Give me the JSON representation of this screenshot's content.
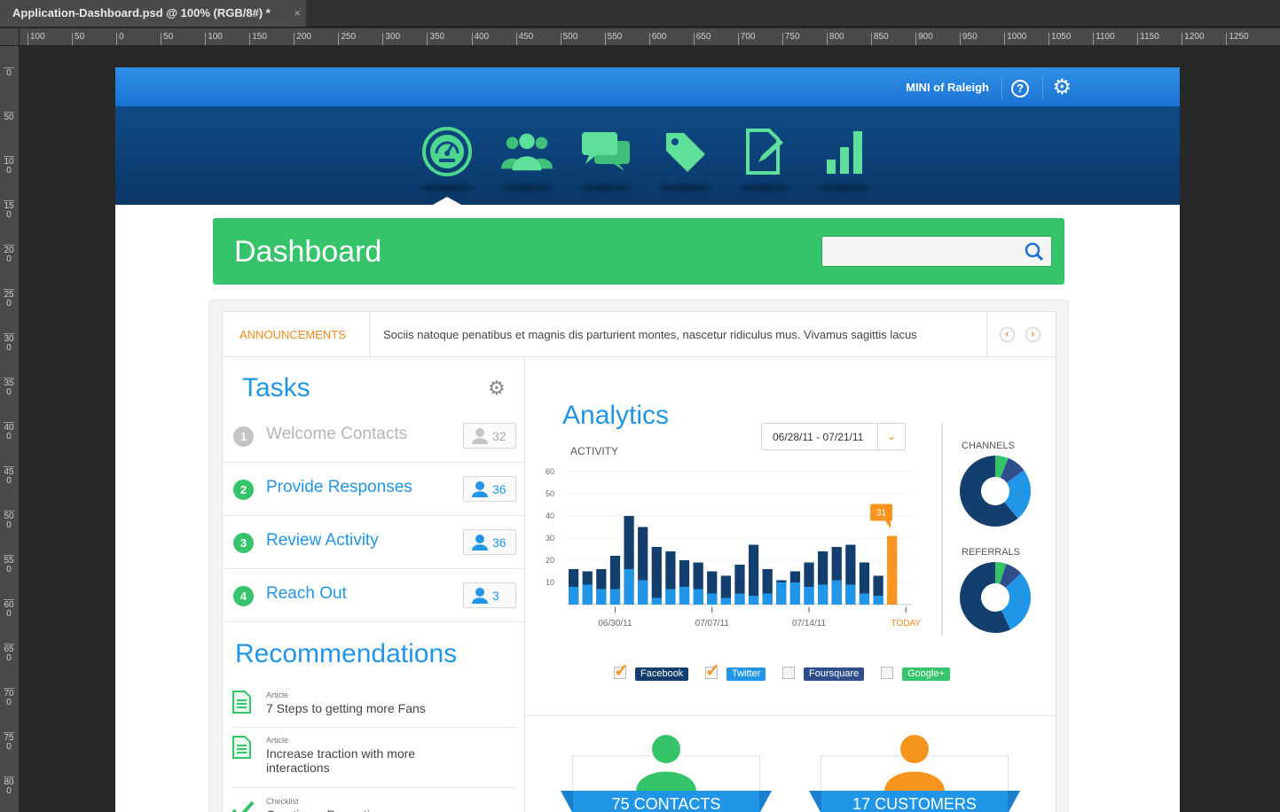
{
  "window": {
    "tab_title": "Application-Dashboard.psd @ 100% (RGB/8#) *",
    "close_glyph": "×"
  },
  "ruler_top": [
    "100",
    "50",
    "0",
    "50",
    "100",
    "150",
    "200",
    "250",
    "300",
    "350",
    "400",
    "450",
    "500",
    "550",
    "600",
    "650",
    "700",
    "750",
    "800",
    "850",
    "900",
    "950",
    "1000",
    "1050",
    "1100",
    "1150",
    "1200",
    "1250"
  ],
  "ruler_left": [
    "0",
    "50",
    "100",
    "150",
    "200",
    "250",
    "300",
    "350",
    "400",
    "450",
    "500",
    "550",
    "600",
    "650",
    "700",
    "750",
    "800"
  ],
  "header": {
    "brand": "MINI of Raleigh",
    "help_glyph": "?",
    "settings_glyph": "⚙"
  },
  "nav_icons": [
    "dashboard-icon",
    "contacts-icon",
    "messages-icon",
    "tags-icon",
    "notes-icon",
    "analytics-bars-icon"
  ],
  "dashboard": {
    "title": "Dashboard",
    "search_value": ""
  },
  "announcement": {
    "label": "ANNOUNCEMENTS",
    "text": "Sociis natoque penatibus et magnis dis parturient montes, nascetur ridiculus mus. Vivamus sagittis lacus",
    "prev": "‹",
    "next": "›"
  },
  "tasks": {
    "title": "Tasks",
    "gear_glyph": "⚙",
    "items": [
      {
        "num": "1",
        "label": "Welcome Contacts",
        "count": "32",
        "state": "done"
      },
      {
        "num": "2",
        "label": "Provide Responses",
        "count": "36",
        "state": "active"
      },
      {
        "num": "3",
        "label": "Review Activity",
        "count": "36",
        "state": "active"
      },
      {
        "num": "4",
        "label": "Reach Out",
        "count": "3",
        "state": "active"
      }
    ]
  },
  "recommendations": {
    "title": "Recommendations",
    "items": [
      {
        "type": "Article",
        "text": "7 Steps to getting more Fans"
      },
      {
        "type": "Article",
        "text": "Increase traction with more interactions"
      },
      {
        "type": "Checklist",
        "text": "Creating a Promotion"
      }
    ]
  },
  "analytics": {
    "title": "Analytics",
    "activity_label": "ACTIVITY",
    "date_range": "06/28/11 - 07/21/11",
    "dropdown_glyph": "⌄",
    "channels_label": "CHANNELS",
    "referrals_label": "REFERRALS"
  },
  "chart_data": {
    "type": "bar",
    "ylim": [
      0,
      60
    ],
    "yticks": [
      "60",
      "50",
      "40",
      "30",
      "20",
      "10"
    ],
    "xtick_labels": [
      "06/30/11",
      "07/07/11",
      "07/14/11",
      "TODAY"
    ],
    "xtick_positions": [
      3,
      10,
      17,
      24
    ],
    "series": [
      {
        "name": "Facebook",
        "color": "#123f6e",
        "values": [
          16,
          15,
          16,
          22,
          40,
          35,
          26,
          24,
          20,
          19,
          15,
          13,
          18,
          27,
          16,
          11,
          15,
          19,
          24,
          26,
          27,
          19,
          13,
          0
        ]
      },
      {
        "name": "Twitter",
        "color": "#2196e6",
        "values": [
          8,
          9,
          7,
          7,
          16,
          11,
          3,
          7,
          8,
          7,
          5,
          3,
          5,
          4,
          5,
          10,
          10,
          8,
          9,
          11,
          9,
          5,
          4,
          3
        ]
      }
    ],
    "highlight": {
      "index": 23,
      "value": 31,
      "label": "31",
      "color": "#f7941d"
    },
    "legend": [
      {
        "name": "Facebook",
        "checked": true,
        "color": "#123f6e"
      },
      {
        "name": "Twitter",
        "checked": true,
        "color": "#2196e6"
      },
      {
        "name": "Foursquare",
        "checked": false,
        "color": "#2e4f8c"
      },
      {
        "name": "Google+",
        "checked": false,
        "color": "#35c46a"
      }
    ]
  },
  "channels_donut": [
    {
      "name": "Google+",
      "value": 6,
      "color": "#35c46a"
    },
    {
      "name": "Foursquare",
      "value": 9,
      "color": "#2e4f8c"
    },
    {
      "name": "Twitter",
      "value": 24,
      "color": "#2196e6"
    },
    {
      "name": "Facebook",
      "value": 61,
      "color": "#123f6e"
    }
  ],
  "referrals_donut": [
    {
      "name": "Google+",
      "value": 5,
      "color": "#35c46a"
    },
    {
      "name": "Foursquare",
      "value": 8,
      "color": "#2e4f8c"
    },
    {
      "name": "Twitter",
      "value": 30,
      "color": "#2196e6"
    },
    {
      "name": "Facebook",
      "value": 57,
      "color": "#123f6e"
    }
  ],
  "stats": {
    "contacts": "75 CONTACTS",
    "customers": "17 CUSTOMERS"
  },
  "colors": {
    "green": "#35c46a",
    "blue": "#2196e6",
    "navy": "#123f6e",
    "orange": "#f7941d"
  }
}
